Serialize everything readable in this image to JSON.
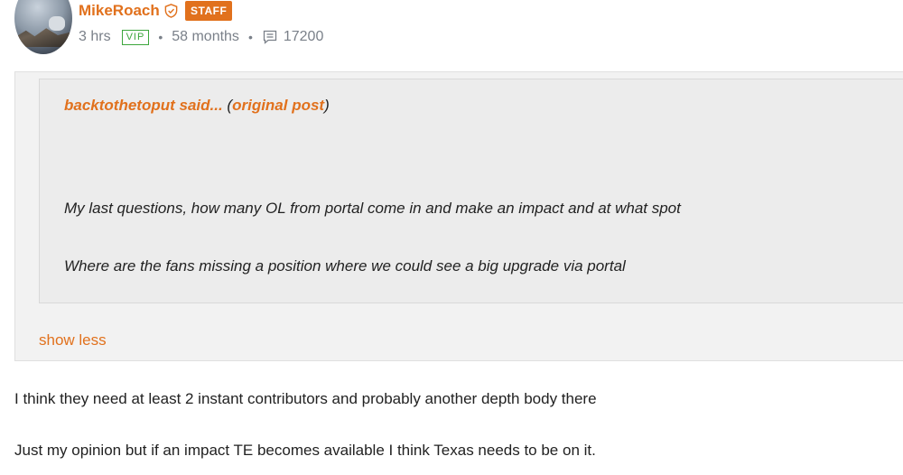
{
  "post": {
    "username": "MikeRoach",
    "staff_badge": "STAFF",
    "time": "3 hrs",
    "vip_badge": "VIP",
    "member_for": "58 months",
    "post_count": "17200"
  },
  "quote": {
    "author": "backtothetoput said...",
    "paren_open": "(",
    "link": "original post",
    "paren_close": ")",
    "lines": [
      "My last questions, how many OL from portal come in and make an impact and at what spot",
      "Where are the fans missing a position where we could see a big upgrade via portal"
    ],
    "toggle_label": "show less"
  },
  "body": {
    "lines": [
      "I think they need at least 2 instant contributors and probably another depth body there",
      "Just my opinion but if an impact TE becomes available I think Texas needs to be on it."
    ]
  },
  "colors": {
    "accent": "#e1711d",
    "vip": "#3ca63c",
    "meta": "#7a8089"
  }
}
